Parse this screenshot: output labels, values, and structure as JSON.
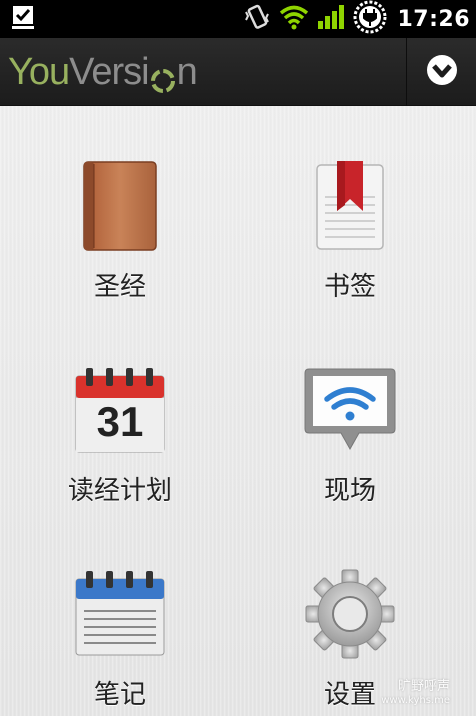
{
  "status_bar": {
    "time": "17:26",
    "icons": [
      "download-done-icon",
      "vibrate-icon",
      "wifi-icon",
      "signal-icon",
      "battery-charging-icon"
    ]
  },
  "header": {
    "logo_you": "You",
    "logo_version": "Versi",
    "logo_version_end": "n",
    "menu_icon": "chevron-down-circle-icon"
  },
  "tiles": [
    {
      "label": "圣经",
      "icon": "bible-book-icon"
    },
    {
      "label": "书签",
      "icon": "bookmark-icon"
    },
    {
      "label": "读经计划",
      "icon": "calendar-icon",
      "calendar_day": "31"
    },
    {
      "label": "现场",
      "icon": "live-broadcast-icon"
    },
    {
      "label": "笔记",
      "icon": "notepad-icon"
    },
    {
      "label": "设置",
      "icon": "gear-icon"
    }
  ],
  "watermark": {
    "line1": "旷野呼声",
    "line2": "www.kyhs.me"
  },
  "colors": {
    "logo_green": "#98b15f",
    "logo_gray": "#8d8d8d",
    "calendar_red": "#d9322c",
    "notes_blue": "#3b78c9",
    "bookmark_red": "#c8242a",
    "wifi_blue": "#2f7fd1"
  }
}
